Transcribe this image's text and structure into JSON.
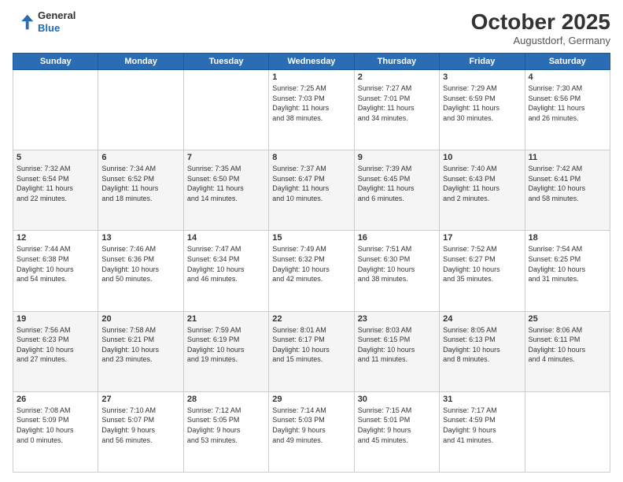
{
  "header": {
    "logo_line1": "General",
    "logo_line2": "Blue",
    "month": "October 2025",
    "location": "Augustdorf, Germany"
  },
  "weekdays": [
    "Sunday",
    "Monday",
    "Tuesday",
    "Wednesday",
    "Thursday",
    "Friday",
    "Saturday"
  ],
  "weeks": [
    [
      {
        "day": "",
        "info": ""
      },
      {
        "day": "",
        "info": ""
      },
      {
        "day": "",
        "info": ""
      },
      {
        "day": "1",
        "info": "Sunrise: 7:25 AM\nSunset: 7:03 PM\nDaylight: 11 hours\nand 38 minutes."
      },
      {
        "day": "2",
        "info": "Sunrise: 7:27 AM\nSunset: 7:01 PM\nDaylight: 11 hours\nand 34 minutes."
      },
      {
        "day": "3",
        "info": "Sunrise: 7:29 AM\nSunset: 6:59 PM\nDaylight: 11 hours\nand 30 minutes."
      },
      {
        "day": "4",
        "info": "Sunrise: 7:30 AM\nSunset: 6:56 PM\nDaylight: 11 hours\nand 26 minutes."
      }
    ],
    [
      {
        "day": "5",
        "info": "Sunrise: 7:32 AM\nSunset: 6:54 PM\nDaylight: 11 hours\nand 22 minutes."
      },
      {
        "day": "6",
        "info": "Sunrise: 7:34 AM\nSunset: 6:52 PM\nDaylight: 11 hours\nand 18 minutes."
      },
      {
        "day": "7",
        "info": "Sunrise: 7:35 AM\nSunset: 6:50 PM\nDaylight: 11 hours\nand 14 minutes."
      },
      {
        "day": "8",
        "info": "Sunrise: 7:37 AM\nSunset: 6:47 PM\nDaylight: 11 hours\nand 10 minutes."
      },
      {
        "day": "9",
        "info": "Sunrise: 7:39 AM\nSunset: 6:45 PM\nDaylight: 11 hours\nand 6 minutes."
      },
      {
        "day": "10",
        "info": "Sunrise: 7:40 AM\nSunset: 6:43 PM\nDaylight: 11 hours\nand 2 minutes."
      },
      {
        "day": "11",
        "info": "Sunrise: 7:42 AM\nSunset: 6:41 PM\nDaylight: 10 hours\nand 58 minutes."
      }
    ],
    [
      {
        "day": "12",
        "info": "Sunrise: 7:44 AM\nSunset: 6:38 PM\nDaylight: 10 hours\nand 54 minutes."
      },
      {
        "day": "13",
        "info": "Sunrise: 7:46 AM\nSunset: 6:36 PM\nDaylight: 10 hours\nand 50 minutes."
      },
      {
        "day": "14",
        "info": "Sunrise: 7:47 AM\nSunset: 6:34 PM\nDaylight: 10 hours\nand 46 minutes."
      },
      {
        "day": "15",
        "info": "Sunrise: 7:49 AM\nSunset: 6:32 PM\nDaylight: 10 hours\nand 42 minutes."
      },
      {
        "day": "16",
        "info": "Sunrise: 7:51 AM\nSunset: 6:30 PM\nDaylight: 10 hours\nand 38 minutes."
      },
      {
        "day": "17",
        "info": "Sunrise: 7:52 AM\nSunset: 6:27 PM\nDaylight: 10 hours\nand 35 minutes."
      },
      {
        "day": "18",
        "info": "Sunrise: 7:54 AM\nSunset: 6:25 PM\nDaylight: 10 hours\nand 31 minutes."
      }
    ],
    [
      {
        "day": "19",
        "info": "Sunrise: 7:56 AM\nSunset: 6:23 PM\nDaylight: 10 hours\nand 27 minutes."
      },
      {
        "day": "20",
        "info": "Sunrise: 7:58 AM\nSunset: 6:21 PM\nDaylight: 10 hours\nand 23 minutes."
      },
      {
        "day": "21",
        "info": "Sunrise: 7:59 AM\nSunset: 6:19 PM\nDaylight: 10 hours\nand 19 minutes."
      },
      {
        "day": "22",
        "info": "Sunrise: 8:01 AM\nSunset: 6:17 PM\nDaylight: 10 hours\nand 15 minutes."
      },
      {
        "day": "23",
        "info": "Sunrise: 8:03 AM\nSunset: 6:15 PM\nDaylight: 10 hours\nand 11 minutes."
      },
      {
        "day": "24",
        "info": "Sunrise: 8:05 AM\nSunset: 6:13 PM\nDaylight: 10 hours\nand 8 minutes."
      },
      {
        "day": "25",
        "info": "Sunrise: 8:06 AM\nSunset: 6:11 PM\nDaylight: 10 hours\nand 4 minutes."
      }
    ],
    [
      {
        "day": "26",
        "info": "Sunrise: 7:08 AM\nSunset: 5:09 PM\nDaylight: 10 hours\nand 0 minutes."
      },
      {
        "day": "27",
        "info": "Sunrise: 7:10 AM\nSunset: 5:07 PM\nDaylight: 9 hours\nand 56 minutes."
      },
      {
        "day": "28",
        "info": "Sunrise: 7:12 AM\nSunset: 5:05 PM\nDaylight: 9 hours\nand 53 minutes."
      },
      {
        "day": "29",
        "info": "Sunrise: 7:14 AM\nSunset: 5:03 PM\nDaylight: 9 hours\nand 49 minutes."
      },
      {
        "day": "30",
        "info": "Sunrise: 7:15 AM\nSunset: 5:01 PM\nDaylight: 9 hours\nand 45 minutes."
      },
      {
        "day": "31",
        "info": "Sunrise: 7:17 AM\nSunset: 4:59 PM\nDaylight: 9 hours\nand 41 minutes."
      },
      {
        "day": "",
        "info": ""
      }
    ]
  ]
}
